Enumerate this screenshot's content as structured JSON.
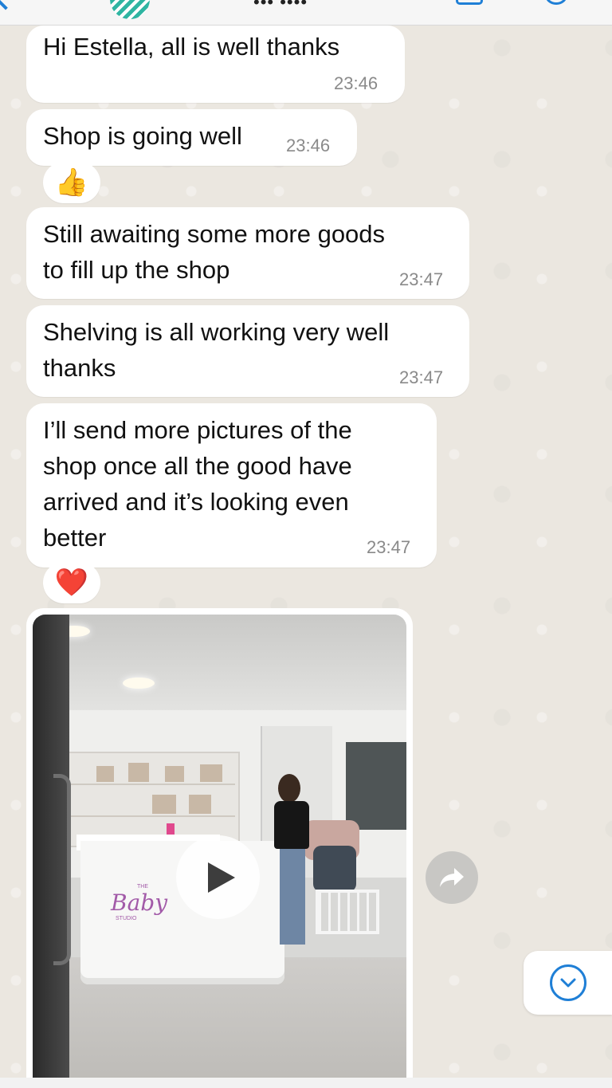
{
  "header": {
    "title": "••• ••••"
  },
  "messages": [
    {
      "text": "Hi Estella, all is well thanks",
      "time": "23:46"
    },
    {
      "text": "Shop is going well",
      "time": "23:46",
      "reaction": "👍"
    },
    {
      "text": "Still awaiting some more goods\nto fill up the shop",
      "time": "23:47"
    },
    {
      "text": "Shelving is all working very well\nthanks",
      "time": "23:47"
    },
    {
      "text": "I’ll send more pictures of the\nshop once all the good have\narrived and it’s looking even\nbetter",
      "time": "23:47",
      "reaction": "❤️"
    }
  ],
  "media": {
    "type": "video",
    "logo_text": "Baby",
    "logo_top": "THE",
    "logo_bottom": "STUDIO"
  },
  "icons": {
    "header_back": "chevron-left-icon",
    "header_video": "video-call-icon",
    "header_call": "phone-icon",
    "play": "play-icon",
    "forward": "forward-icon",
    "scroll": "chevron-down-icon"
  },
  "colors": {
    "accent": "#1f7fd6",
    "bubble": "#ffffff",
    "wallpaper": "#ebe7e0",
    "timestamp": "#8a8a8a"
  }
}
